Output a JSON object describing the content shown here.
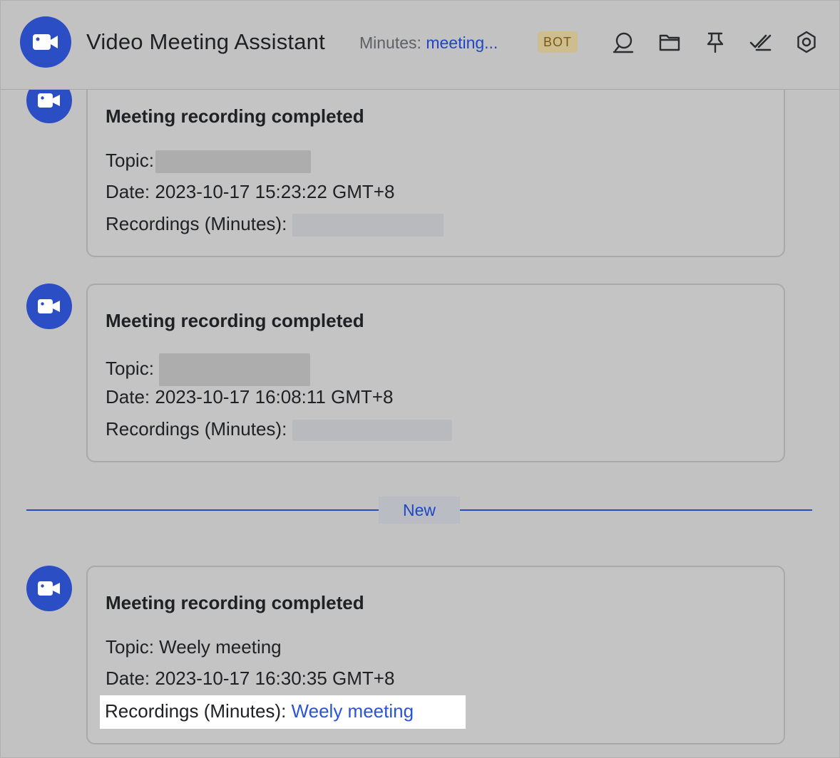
{
  "header": {
    "title": "Video Meeting Assistant",
    "subtitle_prefix": "Minutes: ",
    "subtitle_link": "meeting...",
    "badge": "BOT",
    "icons": [
      "search-icon",
      "folder-icon",
      "pin-icon",
      "double-check-icon",
      "gear-icon"
    ]
  },
  "messages": [
    {
      "title": "Meeting recording completed",
      "topic_label": "Topic:",
      "topic_value": "",
      "date_label": "Date:",
      "date_value": "2023-10-17 15:23:22 GMT+8",
      "recordings_label": "Recordings (Minutes):",
      "recordings_value": ""
    },
    {
      "title": "Meeting recording completed",
      "topic_label": "Topic:",
      "topic_value": "",
      "date_label": "Date:",
      "date_value": "2023-10-17 16:08:11 GMT+8",
      "recordings_label": "Recordings (Minutes):",
      "recordings_value": ""
    },
    {
      "title": "Meeting recording completed",
      "topic_label": "Topic:",
      "topic_value": "Weely meeting",
      "date_label": "Date:",
      "date_value": "2023-10-17 16:30:35 GMT+8",
      "recordings_label": "Recordings (Minutes):",
      "recordings_value": "Weely meeting"
    }
  ],
  "divider": {
    "label": "New"
  },
  "colors": {
    "accent": "#2c4ec4",
    "link": "#2a53d8",
    "badge_bg": "#cdbd8f",
    "badge_text": "#7a5a13"
  }
}
